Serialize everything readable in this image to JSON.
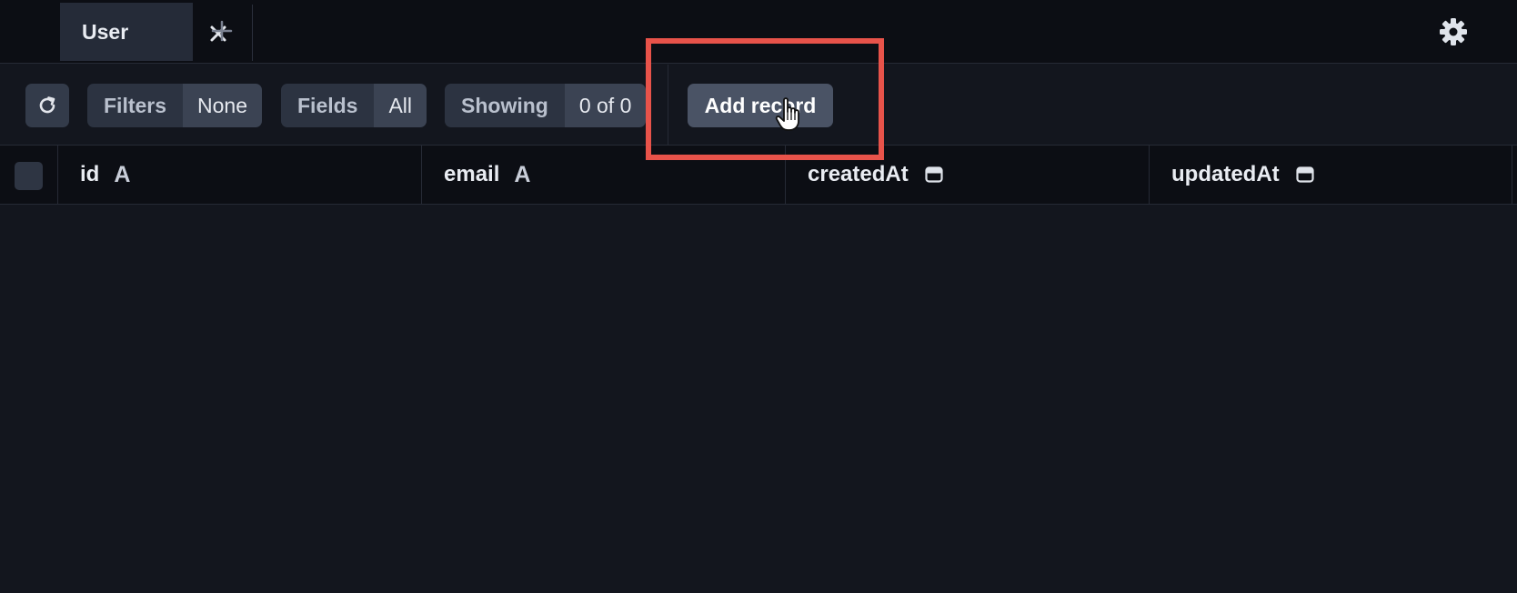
{
  "tabs": [
    {
      "label": "User",
      "icon": "close-icon"
    }
  ],
  "add_tab_icon": "plus-icon",
  "settings_icon": "gear-icon",
  "toolbar": {
    "refresh_icon": "refresh-icon",
    "filters": {
      "key": "Filters",
      "value": "None"
    },
    "fields": {
      "key": "Fields",
      "value": "All"
    },
    "showing": {
      "key": "Showing",
      "value": "0 of 0"
    },
    "add_record_label": "Add record"
  },
  "columns": [
    {
      "label": "id",
      "type_icon": "text-type-icon",
      "type_glyph": "A"
    },
    {
      "label": "email",
      "type_icon": "text-type-icon",
      "type_glyph": "A"
    },
    {
      "label": "createdAt",
      "type_icon": "calendar-icon"
    },
    {
      "label": "updatedAt",
      "type_icon": "calendar-icon"
    }
  ],
  "rows": [],
  "colors": {
    "highlight": "#e8534a",
    "background": "#13161e",
    "header_background": "#0c0e14",
    "button": "#4a5365"
  }
}
